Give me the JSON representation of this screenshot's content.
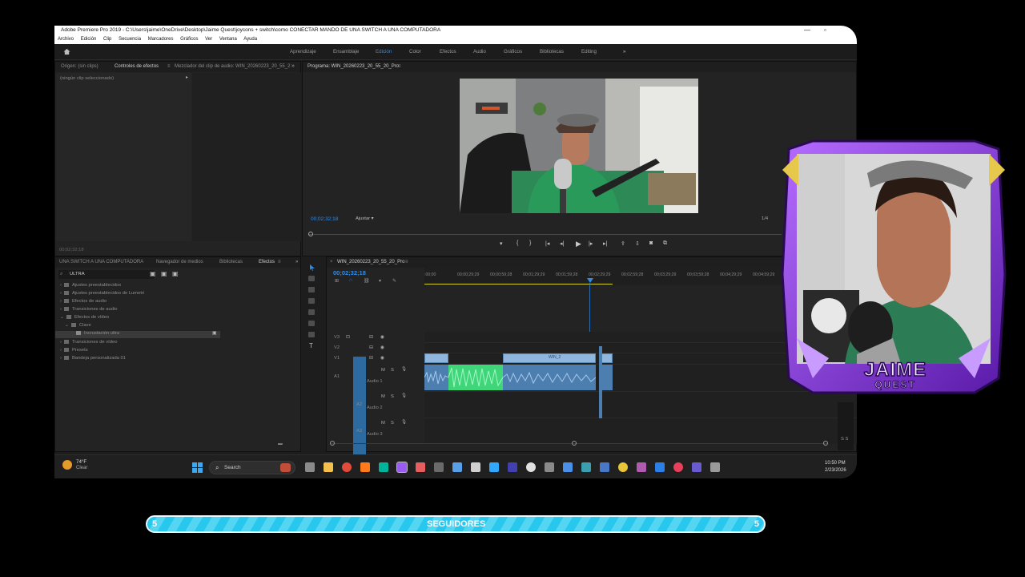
{
  "window": {
    "title": "Adobe Premiere Pro 2019 - C:\\Users\\jaime\\OneDrive\\Desktop\\Jaime Quest\\joycons + switch\\como CONECTAR MANDO DE UNA SWITCH A UNA COMPUTADORA"
  },
  "menu": [
    "Archivo",
    "Edición",
    "Clip",
    "Secuencia",
    "Marcadores",
    "Gráficos",
    "Ver",
    "Ventana",
    "Ayuda"
  ],
  "workspaces": {
    "tabs": [
      "Aprendizaje",
      "Ensamblaje",
      "Edición",
      "Color",
      "Efectos",
      "Audio",
      "Gráficos",
      "Bibliotecas",
      "Editing"
    ],
    "active": "Edición",
    "more": "»"
  },
  "source_panel": {
    "tabs": [
      "Origen: (sin clips)",
      "Controles de efectos",
      "Mezclador del clip de audio: WIN_20260223_20_55_2"
    ],
    "active": "Controles de efectos",
    "no_clip": "(ningún clip seleccionado)",
    "timecode": "00;02;32;18"
  },
  "program_monitor": {
    "title": "Programa: WIN_20260223_20_55_20_Pro",
    "timecode": "00;02;32;18",
    "fit": "Ajustar",
    "fraction": "1/4"
  },
  "effects_panel": {
    "tabs": [
      "UNA SWITCH A UNA COMPUTADORA",
      "Navegador de medios",
      "Bibliotecas",
      "Efectos"
    ],
    "active": "Efectos",
    "search_value": "ULTRA",
    "items": [
      {
        "label": "Ajustes preestablecidos",
        "level": 0
      },
      {
        "label": "Ajustes preestablecidos de Lumetri",
        "level": 0
      },
      {
        "label": "Efectos de audio",
        "level": 0
      },
      {
        "label": "Transiciones de audio",
        "level": 0
      },
      {
        "label": "Efectos de vídeo",
        "level": 0
      },
      {
        "label": "Clave",
        "level": 1
      },
      {
        "label": "Incrustación ultra",
        "level": 2
      },
      {
        "label": "Transiciones de vídeo",
        "level": 0
      },
      {
        "label": "Presets",
        "level": 0
      },
      {
        "label": "Bandeja personalizada 01",
        "level": 0
      }
    ]
  },
  "timeline": {
    "sequence": "WIN_20260223_20_55_20_Pro",
    "timecode": "00;02;32;18",
    "ruler": [
      ":00;00",
      "00;00;29;29",
      "00;00;59;28",
      "00;01;29;29",
      "00;01;59;28",
      "00;02;29;29",
      "00;02;59;28",
      "00;03;29;29",
      "00;03;59;28",
      "00;04;29;29",
      "00;04;59;29",
      "00;0"
    ],
    "video_tracks": [
      "V3",
      "V2",
      "V1"
    ],
    "audio_tracks": [
      {
        "id": "A1",
        "name": "Audio 1"
      },
      {
        "id": "A2",
        "name": "Audio 2"
      },
      {
        "id": "A3",
        "name": "Audio 3"
      }
    ],
    "clip_label": "WIN_2",
    "meter_label": "S S"
  },
  "taskbar": {
    "weather_temp": "74°F",
    "weather_desc": "Clear",
    "search_placeholder": "Search",
    "time": "10:50 PM",
    "date": "2/23/2026"
  },
  "overlay": {
    "brand": "JAIME",
    "brand_sub": "QUEST",
    "followers_label": "SEGUIDORES",
    "followers_current": "5",
    "followers_goal": "5",
    "followers_progress": 1.0
  },
  "colors": {
    "accent": "#2d8ceb",
    "panel": "#232323",
    "clip_video": "#8fb7de",
    "clip_audio": "#4c7fb0",
    "clip_green": "#3fd67a",
    "follow_bar": "#27c7ee",
    "frame_purple": "#8a3ce0"
  }
}
